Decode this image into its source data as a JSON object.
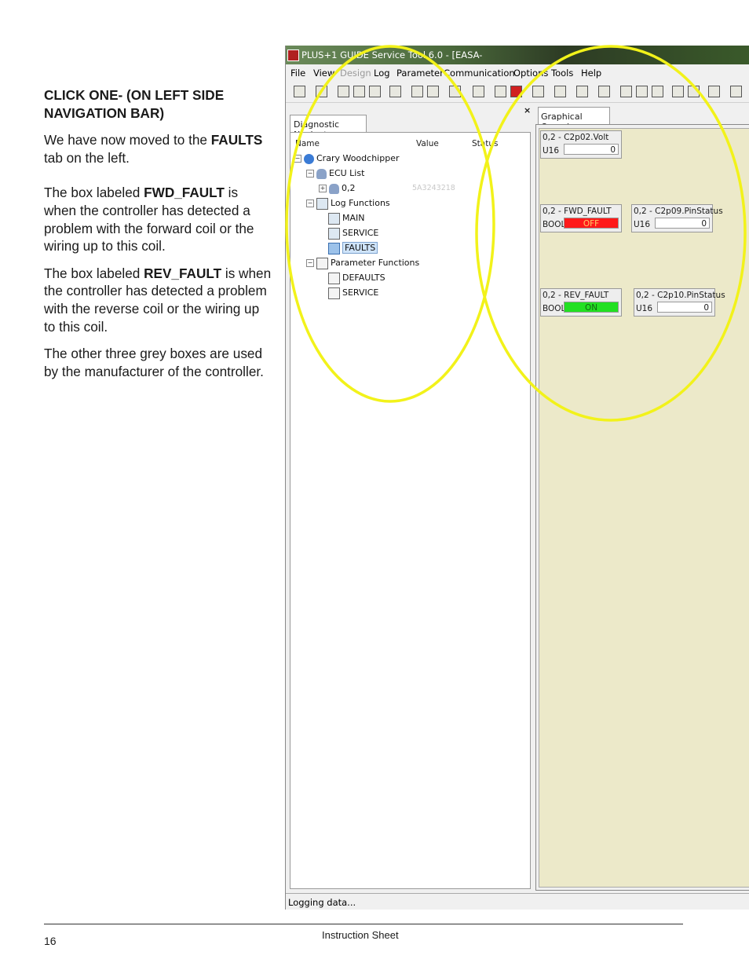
{
  "instructions": {
    "heading": "CLICK ONE- (ON LEFT SIDE NAVIGATION BAR)",
    "p1_a": "We have now moved to the ",
    "p1_b": "FAULTS",
    "p1_c": " tab on the left.",
    "p2_a": "The box labeled ",
    "p2_b": "FWD_FAULT",
    "p2_c": " is when the controller has detected a problem with the forward coil or the wiring up to this coil.",
    "p3_a": "The box labeled ",
    "p3_b": "REV_FAULT",
    "p3_c": " is when the controller has detected a problem with the reverse coil or the wiring up to this coil.",
    "p4": "The other three grey boxes are used by the manufacturer of the controller."
  },
  "app": {
    "title": "PLUS+1 GUIDE Service Tool 6.0 - [EASA-",
    "menu": [
      "File",
      "View",
      "Design",
      "Log",
      "Parameter",
      "Communication",
      "Options",
      "Tools",
      "Help"
    ],
    "nav_tab": "Diagnostic Navigator",
    "close_symbol": "×",
    "columns": {
      "name": "Name",
      "value": "Value",
      "status": "Status"
    },
    "tree": {
      "root": "Crary Woodchipper",
      "ecu_list": "ECU List",
      "ecu_node": "0,2",
      "ecu_value": "5A3243218",
      "log_functions": "Log Functions",
      "log_main": "MAIN",
      "log_service": "SERVICE",
      "log_faults": "FAULTS",
      "parameter_functions": "Parameter Functions",
      "param_defaults": "DEFAULTS",
      "param_service": "SERVICE"
    },
    "overview_tab": "Graphical Overview",
    "boxes": {
      "volt": {
        "name": "0,2 - C2p02.Volt",
        "type": "U16",
        "value": "0"
      },
      "fwd": {
        "name": "0,2 - FWD_FAULT",
        "type": "BOOL",
        "value": "OFF",
        "color": "#ff1a1a"
      },
      "pin09": {
        "name": "0,2 - C2p09.PinStatus",
        "type": "U16",
        "value": "0"
      },
      "rev": {
        "name": "0,2 - REV_FAULT",
        "type": "BOOL",
        "value": "ON",
        "color": "#22e022"
      },
      "pin10": {
        "name": "0,2 - C2p10.PinStatus",
        "type": "U16",
        "value": "0"
      }
    },
    "status_text": "Logging data..."
  },
  "highlight_color": "#f2f21a",
  "footer": {
    "page_number": "16",
    "center_text": "Instruction Sheet"
  }
}
